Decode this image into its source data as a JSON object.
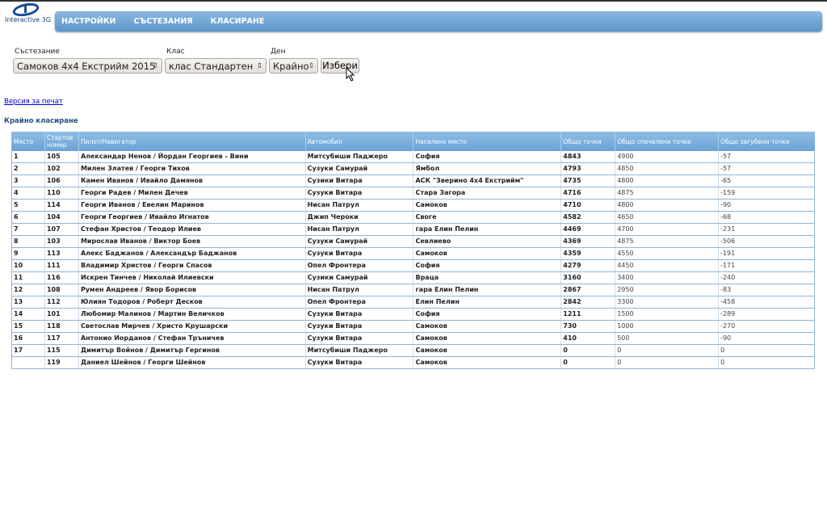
{
  "logo": {
    "text": "Interactive 3G"
  },
  "nav": [
    "НАСТРОЙКИ",
    "СЪСТЕЗАНИЯ",
    "КЛАСИРАНЕ"
  ],
  "filters": {
    "competition": {
      "label": "Състезание",
      "value": "Самоков 4x4 Екстрийм 2015"
    },
    "class": {
      "label": "Клас",
      "value": "клас Стандартен"
    },
    "day": {
      "label": "Ден",
      "value": "Крайно"
    },
    "submit": "Избери"
  },
  "print_link": "Версия за печат",
  "section_title": "Крайно класиране",
  "table": {
    "headers": [
      "Място",
      "Стартов номер",
      "Пилот/Навигатор",
      "Автомобил",
      "Населено място",
      "Общо точки",
      "Общо спечелени точки",
      "Общо загубени точки"
    ],
    "rows": [
      [
        "1",
        "105",
        "Александар Ненов / Йордан Георгиев - Вини",
        "Митсубиши Паджеро",
        "София",
        "4843",
        "4900",
        "-57"
      ],
      [
        "2",
        "102",
        "Милен Златев / Георги Тихов",
        "Сузуки Самурай",
        "Ямбол",
        "4793",
        "4850",
        "-57"
      ],
      [
        "3",
        "106",
        "Камен Иванов / Ивайло Дамянов",
        "Сузики Витара",
        "АСК \"Зверино 4x4 Екстрийм\"",
        "4735",
        "4800",
        "-65"
      ],
      [
        "4",
        "110",
        "Георги Радев / Милен Дечев",
        "Сузуки Витара",
        "Стара Загора",
        "4716",
        "4875",
        "-159"
      ],
      [
        "5",
        "114",
        "Георги Иванов / Евелин Маринов",
        "Нисан Патрул",
        "Самоков",
        "4710",
        "4800",
        "-90"
      ],
      [
        "6",
        "104",
        "Георги Георгиев / Ивайло Игнатов",
        "Джип Чероки",
        "Своге",
        "4582",
        "4650",
        "-68"
      ],
      [
        "7",
        "107",
        "Стефан Христов / Теодор Илиев",
        "Нисан Патрул",
        "гара Елин Пелин",
        "4469",
        "4700",
        "-231"
      ],
      [
        "8",
        "103",
        "Мирослав Иванов / Виктор Боев",
        "Сузуки Самурай",
        "Севлиево",
        "4369",
        "4875",
        "-506"
      ],
      [
        "9",
        "113",
        "Алекс Баджанов / Александър Баджанов",
        "Сузуки Витара",
        "Самоков",
        "4359",
        "4550",
        "-191"
      ],
      [
        "10",
        "111",
        "Владимир Христов / Георги Спасов",
        "Опел Фронтера",
        "София",
        "4279",
        "4450",
        "-171"
      ],
      [
        "11",
        "116",
        "Искрен Тинчев / Николай Илиевски",
        "Сузики Самурай",
        "Враца",
        "3160",
        "3400",
        "-240"
      ],
      [
        "12",
        "108",
        "Румен Андреев / Явор Борисов",
        "Нисан Патрул",
        "гара Елин Пелин",
        "2867",
        "2950",
        "-83"
      ],
      [
        "13",
        "112",
        "Юлиян Тодоров / Роберт Десков",
        "Опел Фронтера",
        "Елин Пелин",
        "2842",
        "3300",
        "-458"
      ],
      [
        "14",
        "101",
        "Любомир Малинов / Мартин Величков",
        "Сузуки Витара",
        "София",
        "1211",
        "1500",
        "-289"
      ],
      [
        "15",
        "118",
        "Светослав Мирчев / Христо Крушарски",
        "Сузуки Витара",
        "Самоков",
        "730",
        "1000",
        "-270"
      ],
      [
        "16",
        "117",
        "Антонио Иорданов / Стефан Тръничев",
        "Сузуки Витара",
        "Самоков",
        "410",
        "500",
        "-90"
      ],
      [
        "17",
        "115",
        "Димитър Войнов / Димитър Гергинов",
        "Митсубиши Паджеро",
        "Самоков",
        "0",
        "0",
        "0"
      ],
      [
        "",
        "119",
        "Даниел Шейнов / Георги Шейнов",
        "Сузуки Витара",
        "Самоков",
        "0",
        "0",
        "0"
      ]
    ]
  }
}
